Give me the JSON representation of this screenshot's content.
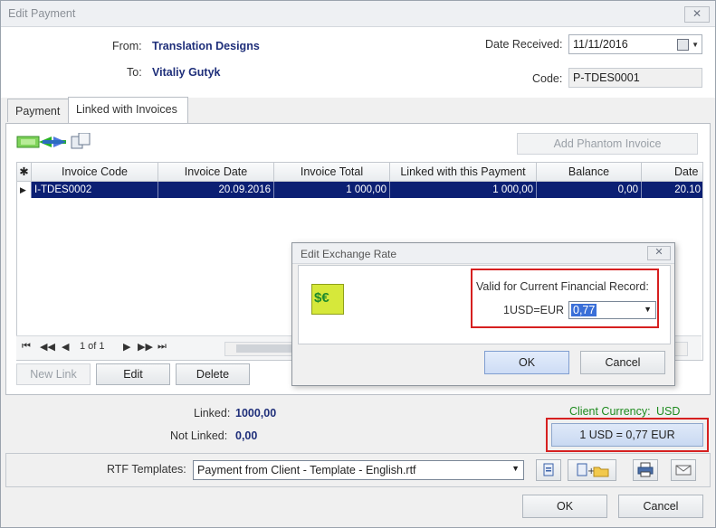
{
  "window": {
    "title": "Edit Payment",
    "close_glyph": "✕"
  },
  "header": {
    "from_label": "From:",
    "from_value": "Translation Designs",
    "to_label": "To:",
    "to_value": "Vitaliy Gutyk",
    "date_label": "Date Received:",
    "date_value": "11/11/2016",
    "code_label": "Code:",
    "code_value": "P-TDES0001"
  },
  "tabs": [
    {
      "label": "Payment",
      "active": false
    },
    {
      "label": "Linked with Invoices",
      "active": true
    }
  ],
  "toolbar": {
    "add_phantom_label": "Add Phantom Invoice"
  },
  "grid": {
    "columns": [
      "Invoice Code",
      "Invoice Date",
      "Invoice Total",
      "Linked with this Payment",
      "Balance",
      "Date"
    ],
    "rows": [
      {
        "code": "I-TDES0002",
        "date": "20.09.2016",
        "total": "1 000,00",
        "linked": "1 000,00",
        "balance": "0,00",
        "date2": "20.10"
      }
    ],
    "pager": "1 of 1",
    "star": "✱"
  },
  "actions": {
    "new_link": "New Link",
    "edit": "Edit",
    "delete": "Delete"
  },
  "exchange_dialog": {
    "title": "Edit Exchange Rate",
    "valid_label": "Valid for Current Financial Record:",
    "pair_label": "1USD=EUR",
    "rate_value": "0,77",
    "ok": "OK",
    "cancel": "Cancel",
    "logo_text": "$€"
  },
  "summary": {
    "linked_label": "Linked:",
    "linked_value": "1000,00",
    "not_linked_label": "Not Linked:",
    "not_linked_value": "0,00",
    "client_currency_label": "Client Currency:",
    "client_currency_value": "USD",
    "rate_display": "1 USD = 0,77 EUR"
  },
  "templates": {
    "label": "RTF Templates:",
    "value": "Payment from Client - Template - English.rtf"
  },
  "footer": {
    "ok": "OK",
    "cancel": "Cancel"
  },
  "colors": {
    "brand_text": "#1f2f7a",
    "selection": "#0b1f73",
    "highlight": "#d62020",
    "currency_green": "#1e8b1e"
  }
}
